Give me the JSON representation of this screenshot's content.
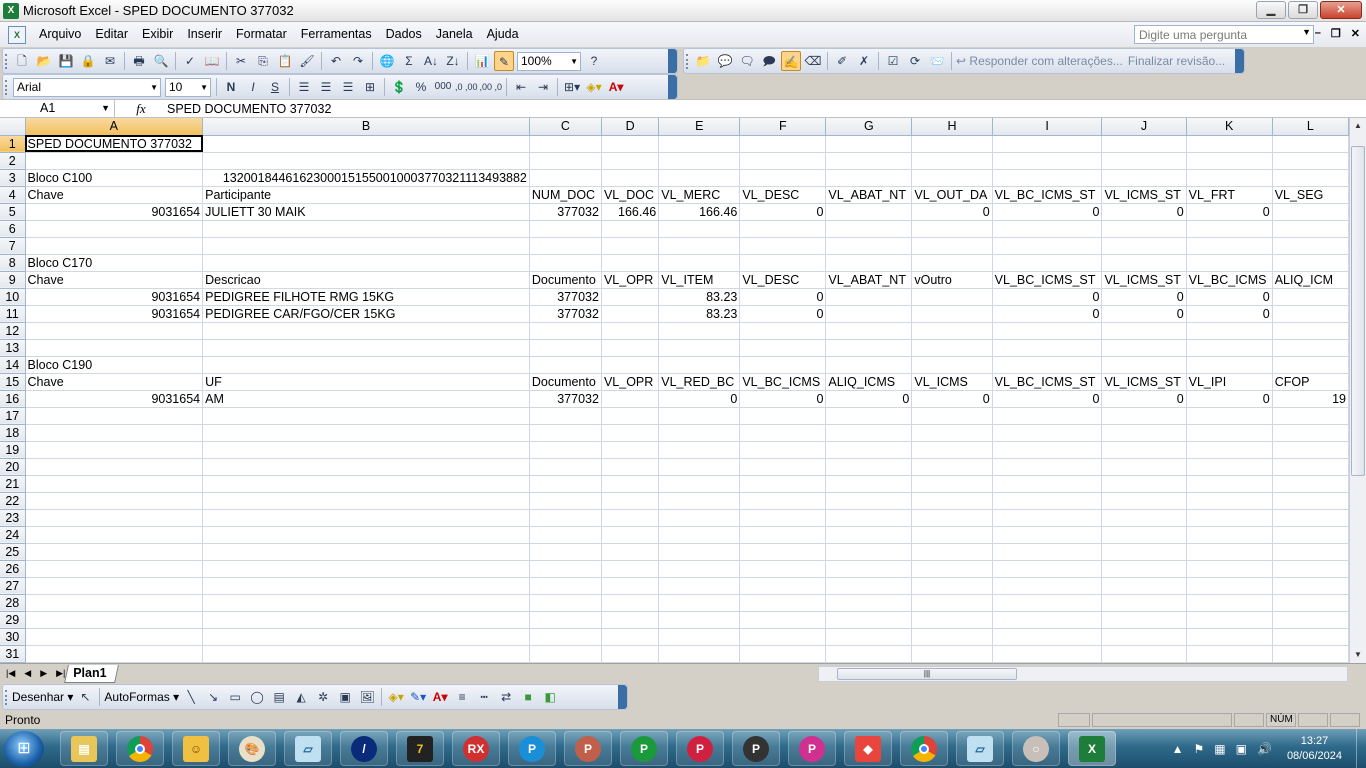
{
  "window": {
    "title": "Microsoft Excel - SPED DOCUMENTO 377032",
    "minimize": "▁",
    "restore": "❐",
    "close": "✕"
  },
  "menu": {
    "items": [
      "Arquivo",
      "Editar",
      "Exibir",
      "Inserir",
      "Formatar",
      "Ferramentas",
      "Dados",
      "Janela",
      "Ajuda"
    ],
    "ask_placeholder": "Digite uma pergunta",
    "mdi_min": "–",
    "mdi_restore": "❐",
    "mdi_close": "✕"
  },
  "standard_toolbar": {
    "zoom": "100%",
    "review_reply": "Responder com alterações...",
    "review_end": "Finalizar revisão..."
  },
  "format_toolbar": {
    "font": "Arial",
    "size": "10",
    "bold": "N",
    "italic": "I",
    "underline": "S",
    "percent": "%",
    "thousands": "000",
    "inc_dec": ",0 ,00",
    "dec_dec": ",00 ,0"
  },
  "formula_bar": {
    "name_box": "A1",
    "fx": "fx",
    "content": "SPED DOCUMENTO 377032"
  },
  "columns": [
    "A",
    "B",
    "C",
    "D",
    "E",
    "F",
    "G",
    "H",
    "I",
    "J",
    "K",
    "L"
  ],
  "rows": [
    [
      "SPED DOCUMENTO 377032",
      "",
      "",
      "",
      "",
      "",
      "",
      "",
      "",
      "",
      "",
      ""
    ],
    [
      "",
      "",
      "",
      "",
      "",
      "",
      "",
      "",
      "",
      "",
      "",
      ""
    ],
    [
      "Bloco C100",
      "13200184461623000151550010003770321113493882",
      "",
      "",
      "",
      "",
      "",
      "",
      "",
      "",
      "",
      ""
    ],
    [
      "Chave",
      "Participante",
      "NUM_DOC",
      "VL_DOC",
      "VL_MERC",
      "VL_DESC",
      "VL_ABAT_NT",
      "VL_OUT_DA",
      "VL_BC_ICMS_ST",
      "VL_ICMS_ST",
      "VL_FRT",
      "VL_SEG"
    ],
    [
      "9031654",
      "JULIETT 30 MAIK",
      "377032",
      "166.46",
      "166.46",
      "0",
      "",
      "0",
      "0",
      "0",
      "0",
      ""
    ],
    [
      "",
      "",
      "",
      "",
      "",
      "",
      "",
      "",
      "",
      "",
      "",
      ""
    ],
    [
      "",
      "",
      "",
      "",
      "",
      "",
      "",
      "",
      "",
      "",
      "",
      ""
    ],
    [
      "Bloco C170",
      "",
      "",
      "",
      "",
      "",
      "",
      "",
      "",
      "",
      "",
      ""
    ],
    [
      "Chave",
      "Descricao",
      "Documento",
      "VL_OPR",
      "VL_ITEM",
      "VL_DESC",
      "VL_ABAT_NT",
      "vOutro",
      "VL_BC_ICMS_ST",
      "VL_ICMS_ST",
      "VL_BC_ICMS",
      "ALIQ_ICM"
    ],
    [
      "9031654",
      "PEDIGREE FILHOTE RMG 15KG",
      "377032",
      "",
      "83.23",
      "0",
      "",
      "",
      "0",
      "0",
      "0",
      ""
    ],
    [
      "9031654",
      "PEDIGREE CAR/FGO/CER 15KG",
      "377032",
      "",
      "83.23",
      "0",
      "",
      "",
      "0",
      "0",
      "0",
      ""
    ],
    [
      "",
      "",
      "",
      "",
      "",
      "",
      "",
      "",
      "",
      "",
      "",
      ""
    ],
    [
      "",
      "",
      "",
      "",
      "",
      "",
      "",
      "",
      "",
      "",
      "",
      ""
    ],
    [
      "Bloco C190",
      "",
      "",
      "",
      "",
      "",
      "",
      "",
      "",
      "",
      "",
      ""
    ],
    [
      "Chave",
      "UF",
      "Documento",
      "VL_OPR",
      "VL_RED_BC",
      "VL_BC_ICMS",
      "ALIQ_ICMS",
      "VL_ICMS",
      "VL_BC_ICMS_ST",
      "VL_ICMS_ST",
      "VL_IPI",
      "CFOP"
    ],
    [
      "9031654",
      "AM",
      "377032",
      "",
      "0",
      "0",
      "0",
      "0",
      "0",
      "0",
      "0",
      "19"
    ],
    [
      "",
      "",
      "",
      "",
      "",
      "",
      "",
      "",
      "",
      "",
      "",
      ""
    ],
    [
      "",
      "",
      "",
      "",
      "",
      "",
      "",
      "",
      "",
      "",
      "",
      ""
    ],
    [
      "",
      "",
      "",
      "",
      "",
      "",
      "",
      "",
      "",
      "",
      "",
      ""
    ],
    [
      "",
      "",
      "",
      "",
      "",
      "",
      "",
      "",
      "",
      "",
      "",
      ""
    ],
    [
      "",
      "",
      "",
      "",
      "",
      "",
      "",
      "",
      "",
      "",
      "",
      ""
    ],
    [
      "",
      "",
      "",
      "",
      "",
      "",
      "",
      "",
      "",
      "",
      "",
      ""
    ],
    [
      "",
      "",
      "",
      "",
      "",
      "",
      "",
      "",
      "",
      "",
      "",
      ""
    ],
    [
      "",
      "",
      "",
      "",
      "",
      "",
      "",
      "",
      "",
      "",
      "",
      ""
    ],
    [
      "",
      "",
      "",
      "",
      "",
      "",
      "",
      "",
      "",
      "",
      "",
      ""
    ],
    [
      "",
      "",
      "",
      "",
      "",
      "",
      "",
      "",
      "",
      "",
      "",
      ""
    ],
    [
      "",
      "",
      "",
      "",
      "",
      "",
      "",
      "",
      "",
      "",
      "",
      ""
    ],
    [
      "",
      "",
      "",
      "",
      "",
      "",
      "",
      "",
      "",
      "",
      "",
      ""
    ],
    [
      "",
      "",
      "",
      "",
      "",
      "",
      "",
      "",
      "",
      "",
      "",
      ""
    ],
    [
      "",
      "",
      "",
      "",
      "",
      "",
      "",
      "",
      "",
      "",
      "",
      ""
    ],
    [
      "",
      "",
      "",
      "",
      "",
      "",
      "",
      "",
      "",
      "",
      "",
      ""
    ]
  ],
  "sheet_tabs": [
    "Plan1"
  ],
  "draw_toolbar": {
    "draw": "Desenhar",
    "autoshapes": "AutoFormas"
  },
  "status": {
    "text": "Pronto",
    "num": "NÚM"
  },
  "taskbar": {
    "time": "13:27",
    "date": "08/06/2024"
  }
}
